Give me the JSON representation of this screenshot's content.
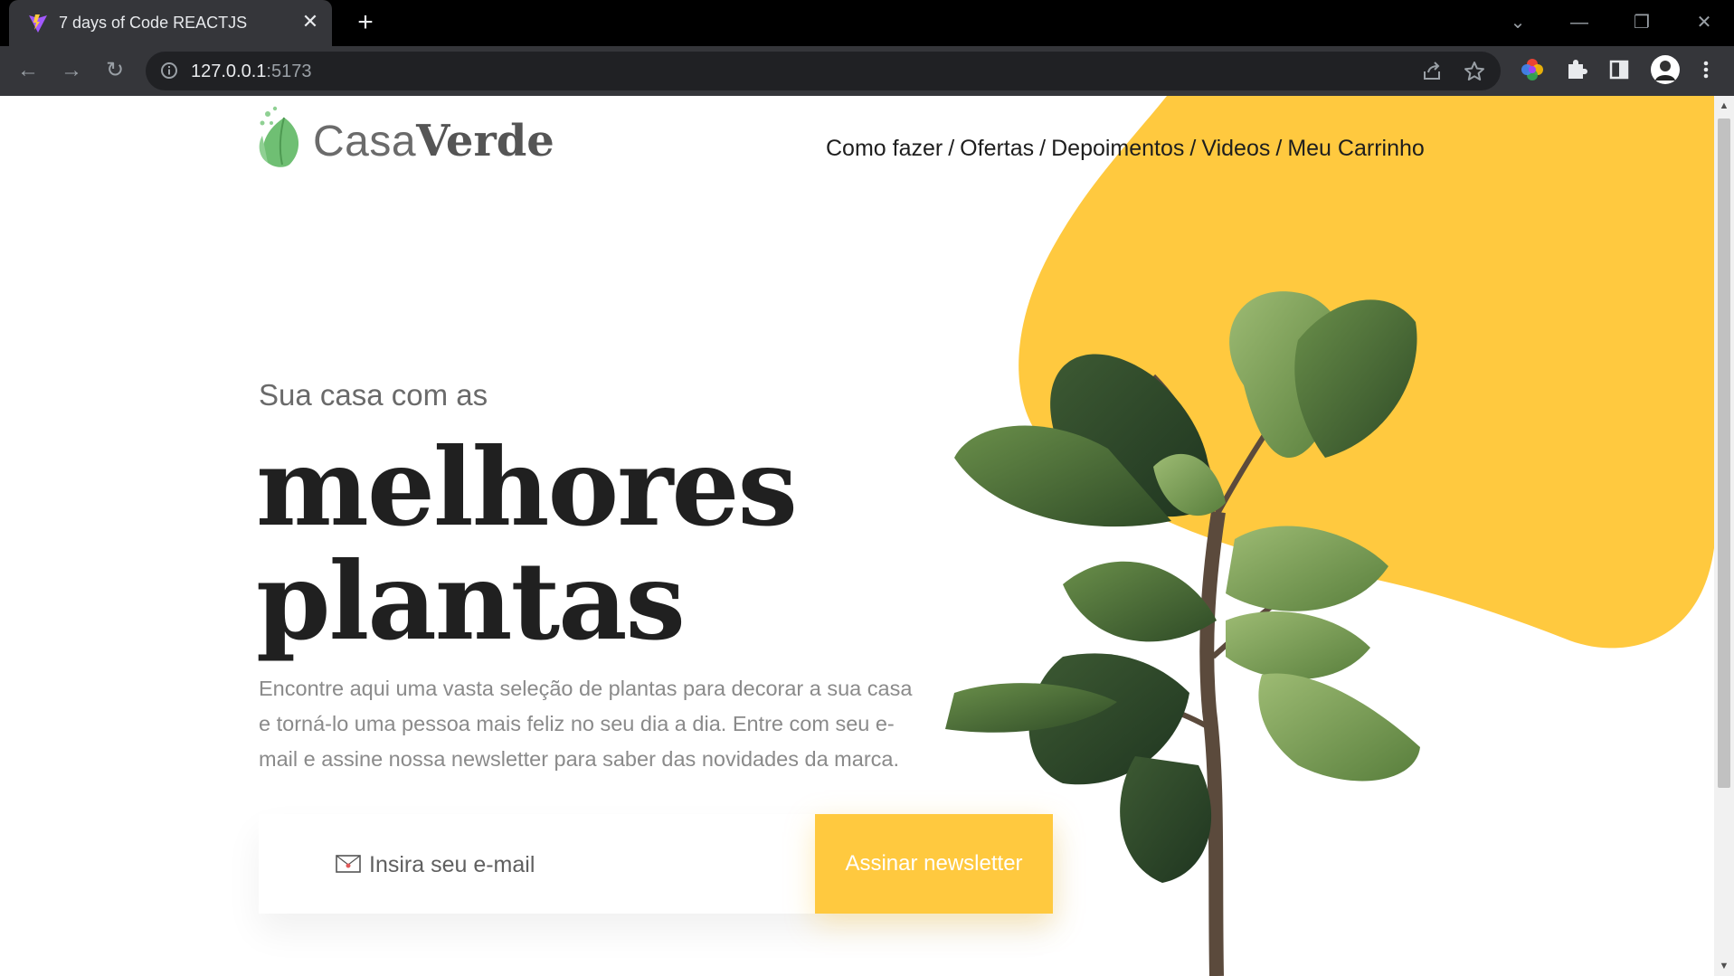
{
  "browser": {
    "tab_title": "7 days of Code REACTJS",
    "tab_close": "✕",
    "new_tab": "+",
    "url_host": "127.0.0.1",
    "url_port": ":5173",
    "back": "←",
    "forward": "→",
    "reload": "↻",
    "minimize": "—",
    "restore": "❐",
    "close": "✕",
    "tab_search": "⌄"
  },
  "header": {
    "logo_casa": "Casa",
    "logo_verde": "Verde",
    "nav": [
      {
        "label": "Como fazer"
      },
      {
        "label": "Ofertas"
      },
      {
        "label": "Depoimentos"
      },
      {
        "label": "Videos"
      },
      {
        "label": "Meu Carrinho"
      }
    ],
    "separator": "/"
  },
  "hero": {
    "subtitle": "Sua casa com as",
    "title_line1": "melhores",
    "title_line2": "plantas",
    "description": "Encontre aqui uma vasta seleção de plantas para decorar a sua casa e torná-lo uma pessoa mais feliz no seu dia a dia. Entre com seu e-mail e assine nossa newsletter para saber das novidades da marca."
  },
  "newsletter": {
    "placeholder": "Insira seu e-mail",
    "button_label": "Assinar newsletter"
  },
  "colors": {
    "accent": "#ffc93f",
    "logo_green": "#6fbf73",
    "heading": "#202020",
    "text_muted": "#8a8a8a"
  }
}
